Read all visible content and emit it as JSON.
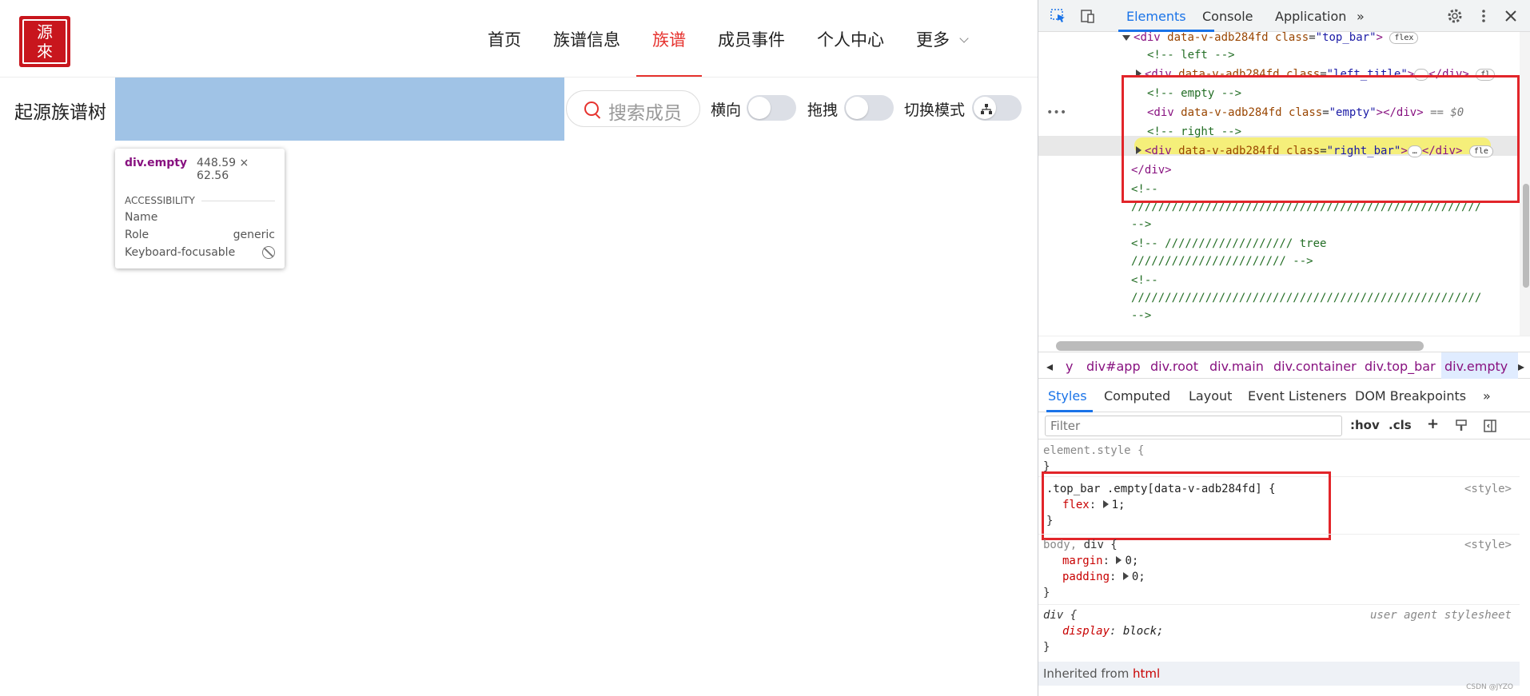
{
  "page": {
    "logo": {
      "char1": "源",
      "char2": "來"
    },
    "nav": [
      "首页",
      "族谱信息",
      "族谱",
      "成员事件",
      "个人中心",
      "更多"
    ],
    "nav_active": "族谱",
    "tree_title": "起源族谱树",
    "search_placeholder": "搜索成员",
    "switch_labels": [
      "横向",
      "拖拽",
      "切换模式"
    ],
    "accent_color": "#e6322e"
  },
  "tooltip": {
    "element": "div.empty",
    "dimensions": "448.59 × 62.56",
    "section": "ACCESSIBILITY",
    "rows": [
      {
        "label": "Name",
        "value": ""
      },
      {
        "label": "Role",
        "value": "generic"
      },
      {
        "label": "Keyboard-focusable",
        "value": ""
      }
    ]
  },
  "devtools": {
    "tabs": [
      "Elements",
      "Console",
      "Application"
    ],
    "active_tab": "Elements",
    "dom_lines": {
      "l1_tag": "div",
      "l1_attr1": "data-v-adb284fd",
      "l1_attr2": "class",
      "l1_val": "\"top_bar\"",
      "l1_pill": "flex",
      "c_left": "<!-- left -->",
      "l2_val": "\"left_title\"",
      "c_empty": "<!-- empty -->",
      "l3_val": "\"empty\"",
      "l3_suffix": "== $0",
      "c_right": "<!-- right -->",
      "l4_val": "\"right_bar\"",
      "close_div": "</div>",
      "c_open1": "<!--",
      "slashes1": "////////////////////////////////////////////////////",
      "c_close1": "-->",
      "c_tree_a": "<!-- ///////////////////        tree",
      "c_tree_b": "/////////////////////// -->",
      "c_open2": "<!--",
      "slashes2": "////////////////////////////////////////////////////",
      "c_close2": "-->",
      "pill_fl": "fl",
      "pill_fle": "fle",
      "ellipsis": "…"
    },
    "breadcrumbs": [
      "y",
      "div#app",
      "div.root",
      "div.main",
      "div.container",
      "div.top_bar",
      "div.empty"
    ],
    "subtabs": [
      "Styles",
      "Computed",
      "Layout",
      "Event Listeners",
      "DOM Breakpoints"
    ],
    "active_subtab": "Styles",
    "filter_placeholder": "Filter",
    "filter_buttons": [
      ":hov",
      ".cls",
      "+"
    ],
    "styles": {
      "element_style": "element.style {",
      "close_brace": "}",
      "rule1_selector": ".top_bar .empty[data-v-adb284fd] {",
      "rule1_source": "<style>",
      "rule1_prop": "flex",
      "rule1_value": "1;",
      "rule2_selector_grey": "body,",
      "rule2_selector": "div {",
      "rule2_source": "<style>",
      "rule2_p1": "margin",
      "rule2_v1": "0;",
      "rule2_p2": "padding",
      "rule2_v2": "0;",
      "rule3_selector": "div {",
      "rule3_source": "user agent stylesheet",
      "rule3_prop": "display",
      "rule3_value": "block;",
      "inherited_label": "Inherited from",
      "inherited_tag": "html"
    },
    "watermark": "CSDN @JYZO"
  }
}
